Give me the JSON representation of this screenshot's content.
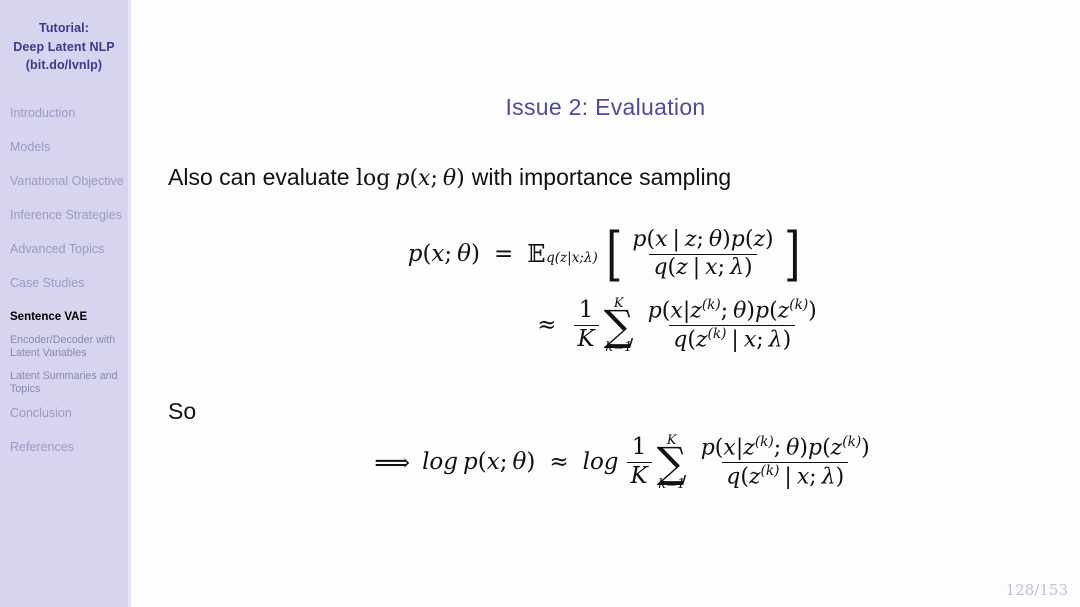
{
  "sidebar": {
    "title_lines": [
      "Tutorial:",
      "Deep Latent NLP",
      "(bit.do/lvnlp)"
    ],
    "items": [
      {
        "label": "Introduction",
        "level": "section",
        "active": false
      },
      {
        "label": "Models",
        "level": "section",
        "active": false
      },
      {
        "label": "Variational Objective",
        "level": "section",
        "active": false
      },
      {
        "label": "Inference Strategies",
        "level": "section",
        "active": false
      },
      {
        "label": "Advanced Topics",
        "level": "section",
        "active": false
      },
      {
        "label": "Case Studies",
        "level": "section",
        "active": false
      },
      {
        "label": "Sentence VAE",
        "level": "subsection",
        "active": true
      },
      {
        "label": "Encoder/Decoder with Latent Variables",
        "level": "subsection",
        "active": false
      },
      {
        "label": "Latent Summaries and Topics",
        "level": "subsection",
        "active": false
      },
      {
        "label": "Conclusion",
        "level": "section",
        "active": false
      },
      {
        "label": "References",
        "level": "section",
        "active": false
      }
    ],
    "colors": {
      "background": "#d6d4ef",
      "title": "#3d3a8c",
      "item": "#9d9ac4",
      "active_item": "#000000"
    }
  },
  "main": {
    "title": "Issue 2: Evaluation",
    "title_color": "#4e4b9e",
    "intro_text_before": "Also can evaluate",
    "intro_text_after": "with importance sampling",
    "intro_math": "log p(x; θ)",
    "so_label": "So",
    "equations": [
      {
        "id": "eq-expectation",
        "latex": "p(x;\\theta) = \\mathbb{E}_{q(z\\mid x;\\lambda)}\\left[\\frac{p(x\\mid z;\\theta)p(z)}{q(z\\mid x;\\lambda)}\\right]"
      },
      {
        "id": "eq-importance-sample",
        "latex": "\\approx \\frac{1}{K}\\sum_{k=1}^{K} \\frac{p(x\\mid z^{(k)};\\theta)p(z^{(k)})}{q(z^{(k)}\\mid x;\\lambda)}"
      },
      {
        "id": "eq-log-estimator",
        "latex": "\\implies \\log p(x;\\theta) \\approx \\log\\frac{1}{K}\\sum_{k=1}^{K}\\frac{p(x\\mid z^{(k)};\\theta)p(z^{(k)})}{q(z^{(k)}\\mid x;\\lambda)}"
      }
    ],
    "symbols": {
      "p": "p",
      "q": "q",
      "x": "x",
      "z": "z",
      "k": "k",
      "K": "K",
      "theta": "θ",
      "lambda": "λ",
      "mid": "|",
      "semicolon": ";",
      "equals": "=",
      "approx": "≈",
      "sum": "∑",
      "expect": "𝔼",
      "implies": "⟹",
      "log": "log",
      "one": "1",
      "k_eq_1": "k=1",
      "lbrack": "[",
      "rbrack": "]",
      "lparen": "(",
      "rparen": ")",
      "sup_k": "(k)"
    }
  },
  "footer": {
    "page": "128/153",
    "color": "#bfbde0"
  }
}
